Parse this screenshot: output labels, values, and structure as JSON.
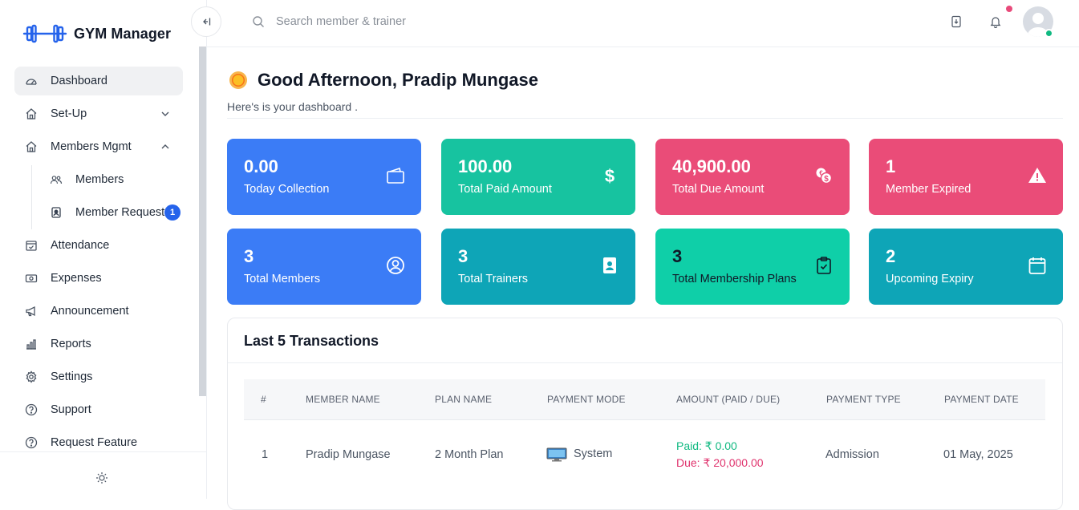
{
  "app": {
    "name": "GYM Manager"
  },
  "sidebar": {
    "items": [
      {
        "label": "Dashboard"
      },
      {
        "label": "Set-Up"
      },
      {
        "label": "Members Mgmt"
      },
      {
        "label": "Members"
      },
      {
        "label": "Member Request",
        "badge": "1"
      },
      {
        "label": "Attendance"
      },
      {
        "label": "Expenses"
      },
      {
        "label": "Announcement"
      },
      {
        "label": "Reports"
      },
      {
        "label": "Settings"
      },
      {
        "label": "Support"
      },
      {
        "label": "Request Feature"
      }
    ]
  },
  "topbar": {
    "search_placeholder": "Search member & trainer"
  },
  "greeting": {
    "title": "Good Afternoon, Pradip Mungase",
    "subtitle": "Here's is your dashboard ."
  },
  "cards": [
    {
      "value": "0.00",
      "label": "Today Collection",
      "color": "#3b7cf6",
      "icon": "wallet-icon"
    },
    {
      "value": "100.00",
      "label": "Total Paid Amount",
      "color": "#17c3a0",
      "icon": "dollar-icon"
    },
    {
      "value": "40,900.00",
      "label": "Total Due Amount",
      "color": "#ea4c78",
      "icon": "coins-icon"
    },
    {
      "value": "1",
      "label": "Member Expired",
      "color": "#ea4c78",
      "icon": "warning-icon"
    },
    {
      "value": "3",
      "label": "Total Members",
      "color": "#3b7cf6",
      "icon": "user-circle-icon"
    },
    {
      "value": "3",
      "label": "Total Trainers",
      "color": "#0ea5b7",
      "icon": "id-badge-icon"
    },
    {
      "value": "3",
      "label": "Total Membership Plans",
      "color": "#0fcfa8",
      "icon": "clipboard-check-icon"
    },
    {
      "value": "2",
      "label": "Upcoming Expiry",
      "color": "#0ea5b7",
      "icon": "calendar-icon"
    }
  ],
  "transactions": {
    "title": "Last 5 Transactions",
    "columns": [
      "#",
      "MEMBER NAME",
      "PLAN NAME",
      "PAYMENT MODE",
      "AMOUNT (PAID / DUE)",
      "PAYMENT TYPE",
      "PAYMENT DATE"
    ],
    "rows": [
      {
        "index": "1",
        "member": "Pradip Mungase",
        "plan": "2 Month Plan",
        "mode": "System",
        "paid": "Paid: ₹ 0.00",
        "due": "Due: ₹ 20,000.00",
        "type": "Admission",
        "date": "01 May, 2025"
      }
    ]
  }
}
